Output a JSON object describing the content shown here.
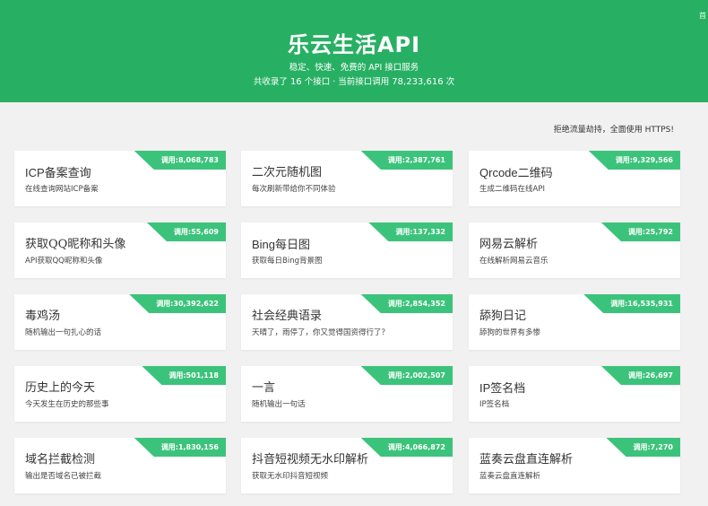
{
  "header": {
    "corner_text": "首",
    "title": "乐云生活API",
    "subtitle": "稳定、快速、免费的 API 接口服务",
    "stats_prefix": "共收录了",
    "api_count": "16",
    "stats_mid": "个接口 · 当前接口调用",
    "total_calls": "78,233,616",
    "stats_suffix": "次"
  },
  "notice": "拒绝流量劫持，全面使用 HTTPS!",
  "colors": {
    "brand": "#27b063",
    "ribbon": "#3cc37b",
    "background": "#f1f1f1"
  },
  "cards": [
    {
      "title": "ICP备案查询",
      "desc": "在线查询网站ICP备案",
      "calls": "调用:8,068,783"
    },
    {
      "title": "二次元随机图",
      "desc": "每次刷新带给你不同体验",
      "calls": "调用:2,387,761"
    },
    {
      "title": "Qrcode二维码",
      "desc": "生成二维码在线API",
      "calls": "调用:9,329,566"
    },
    {
      "title": "获取QQ昵称和头像",
      "desc": "API获取QQ昵称和头像",
      "calls": "调用:55,609"
    },
    {
      "title": "Bing每日图",
      "desc": "获取每日Bing背景图",
      "calls": "调用:137,332"
    },
    {
      "title": "网易云解析",
      "desc": "在线解析网易云音乐",
      "calls": "调用:25,792"
    },
    {
      "title": "毒鸡汤",
      "desc": "随机输出一句扎心的话",
      "calls": "调用:30,392,622"
    },
    {
      "title": "社会经典语录",
      "desc": "天晴了，雨停了，你又觉得国资得行了？",
      "calls": "调用:2,854,352"
    },
    {
      "title": "舔狗日记",
      "desc": "舔狗的世界有多惨",
      "calls": "调用:16,535,931"
    },
    {
      "title": "历史上的今天",
      "desc": "今天发生在历史的那些事",
      "calls": "调用:501,118"
    },
    {
      "title": "一言",
      "desc": "随机输出一句话",
      "calls": "调用:2,002,507"
    },
    {
      "title": "IP签名档",
      "desc": "IP签名档",
      "calls": "调用:26,697"
    },
    {
      "title": "域名拦截检测",
      "desc": "输出是否域名已被拦截",
      "calls": "调用:1,830,156"
    },
    {
      "title": "抖音短视频无水印解析",
      "desc": "获取无水印抖音短视频",
      "calls": "调用:4,066,872"
    },
    {
      "title": "蓝奏云盘直连解析",
      "desc": "蓝奏云盘直连解析",
      "calls": "调用:7,270"
    }
  ]
}
